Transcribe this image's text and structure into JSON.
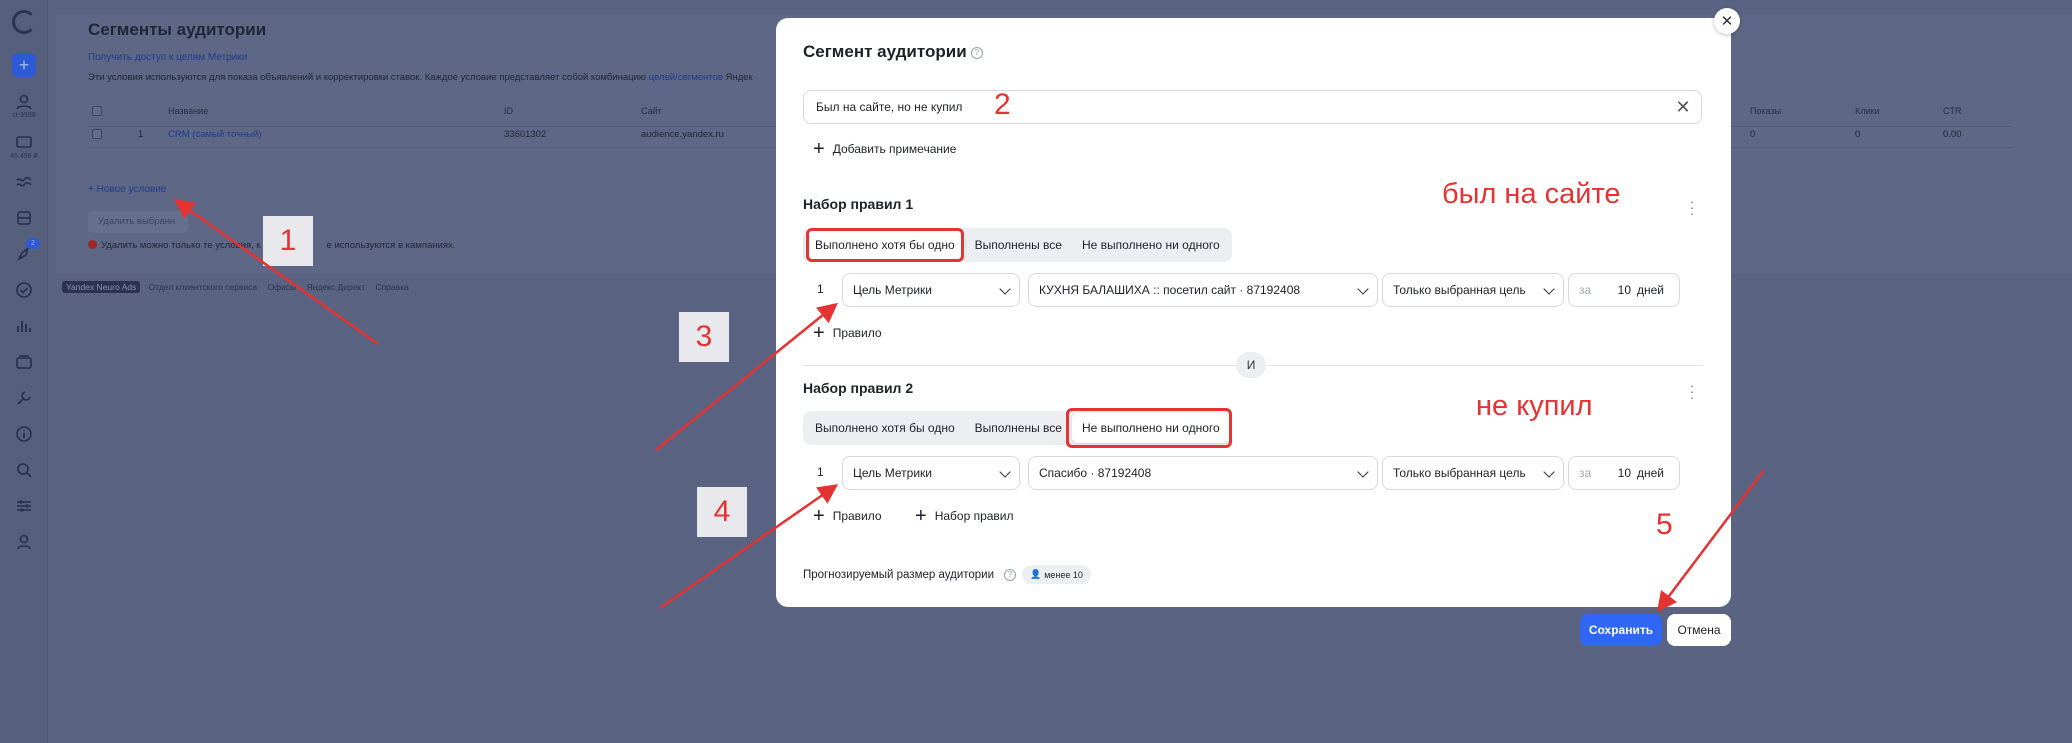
{
  "background": {
    "page_title": "Сегменты аудитории",
    "metrika_link": "Получить доступ к целям Метрики",
    "description": "Эти условия используются для показа объявлений и корректировки ставок. Каждое условие представляет собой комбинацию",
    "description_link": "целей/сегментов",
    "description_tail": "Яндек",
    "rail": {
      "account_label": "ct-3598",
      "balance_label": "45 456 ₽",
      "badge_count": "2"
    },
    "table": {
      "headers": [
        "Название",
        "ID",
        "Сайт",
        "Показы",
        "Клики",
        "CTR"
      ],
      "row": {
        "index": "1",
        "name": "CRM (самый точный)",
        "id": "33601302",
        "site": "audience.yandex.ru",
        "shows": "0",
        "clicks": "0",
        "ctr": "0.00"
      }
    },
    "new_condition": "Новое условие",
    "delete_selected": "Удалить выбранн",
    "warning": "Удалить можно только те условия, к",
    "warning_tail": "е используются в кампаниях.",
    "footer": {
      "badge": "Yandex Neuro Ads",
      "items": [
        "Отдел клиентского сервиса",
        "Офисы",
        "Яндекс Директ",
        "Справка"
      ]
    }
  },
  "modal": {
    "title": "Сегмент аудитории",
    "name_value": "Был на сайте, но не купил",
    "add_note": "Добавить примечание",
    "rule_set_1": {
      "title": "Набор правил 1",
      "options": [
        "Выполнено хотя бы одно",
        "Выполнены все",
        "Не выполнено ни одного"
      ],
      "selected": 0,
      "rule": {
        "num": "1",
        "type": "Цель Метрики",
        "goal": "КУХНЯ БАЛАШИХА :: посетил сайт · 87192408",
        "scope": "Только выбранная цель",
        "days_prefix": "за",
        "days_value": "10",
        "days_suffix": "дней"
      },
      "add_rule": "Правило"
    },
    "and_label": "И",
    "rule_set_2": {
      "title": "Набор правил 2",
      "options": [
        "Выполнено хотя бы одно",
        "Выполнены все",
        "Не выполнено ни одного"
      ],
      "selected": 2,
      "rule": {
        "num": "1",
        "type": "Цель Метрики",
        "goal": "Спасибо · 87192408",
        "scope": "Только выбранная цель",
        "days_prefix": "за",
        "days_value": "10",
        "days_suffix": "дней"
      },
      "add_rule": "Правило",
      "add_rule_set": "Набор правил"
    },
    "forecast_label": "Прогнозируемый размер аудитории",
    "forecast_value": "менее 10"
  },
  "actions": {
    "save": "Сохранить",
    "cancel": "Отмена"
  },
  "annotations": {
    "n1": "1",
    "n2": "2",
    "n3": "3",
    "n4": "4",
    "n5": "5",
    "visited_site": "был на сайте",
    "not_bought": "не купил",
    "color": "#e53232"
  }
}
